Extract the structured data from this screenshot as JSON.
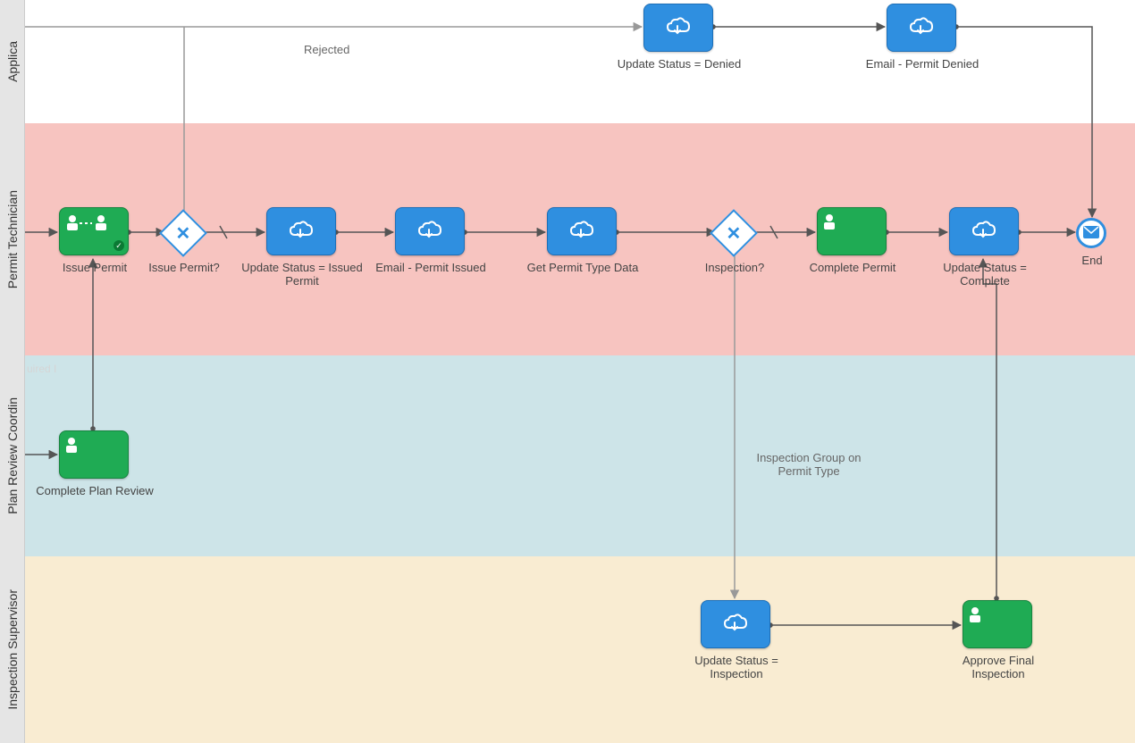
{
  "lanes": {
    "applicant": "Applica",
    "permit_tech": "Permit Technician",
    "plan_review": "Plan Review Coordin",
    "inspection_sup": "Inspection Supervisor"
  },
  "nodes": {
    "update_denied": "Update Status = Denied",
    "email_denied": "Email - Permit Denied",
    "issue_permit": "Issue Permit",
    "gw_issue": "Issue Permit?",
    "update_issued": "Update Status = Issued Permit",
    "email_issued": "Email - Permit Issued",
    "get_permit_type": "Get Permit Type Data",
    "gw_inspection": "Inspection?",
    "complete_permit": "Complete Permit",
    "update_complete": "Update Status = Complete",
    "end": "End",
    "complete_plan_review": "Complete Plan Review",
    "update_inspection": "Update Status = Inspection",
    "approve_final": "Approve Final Inspection"
  },
  "edges": {
    "rejected": "Rejected",
    "insp_group": "Inspection Group on Permit Type"
  },
  "faded_text": "uired I"
}
